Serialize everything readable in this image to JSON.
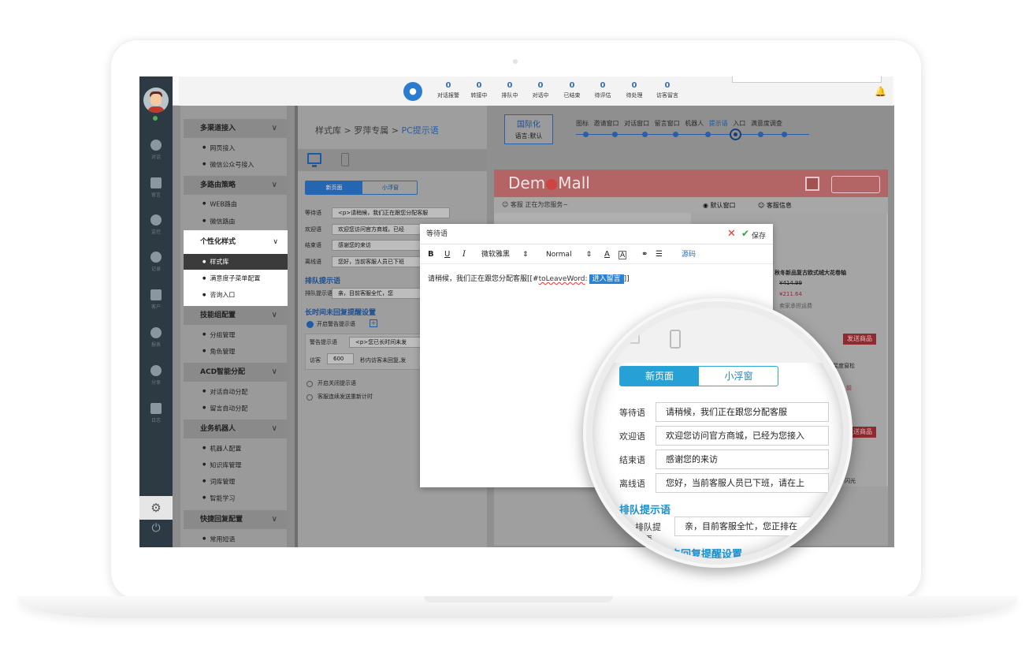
{
  "stats": [
    {
      "num": "0",
      "label": "对话报警"
    },
    {
      "num": "0",
      "label": "转接中"
    },
    {
      "num": "0",
      "label": "排队中"
    },
    {
      "num": "0",
      "label": "对话中"
    },
    {
      "num": "0",
      "label": "已结束"
    },
    {
      "num": "0",
      "label": "待评估"
    },
    {
      "num": "0",
      "label": "待处理"
    },
    {
      "num": "0",
      "label": "访客留言"
    }
  ],
  "leftbar": [
    {
      "icon": "chat-icon",
      "label": "对话"
    },
    {
      "icon": "mail-icon",
      "label": "留言"
    },
    {
      "icon": "eye-icon",
      "label": "监控"
    },
    {
      "icon": "clock-icon",
      "label": "记录"
    },
    {
      "icon": "contacts-icon",
      "label": "客户"
    },
    {
      "icon": "pie-icon",
      "label": "报表"
    },
    {
      "icon": "share-icon",
      "label": "分享"
    },
    {
      "icon": "clipboard-icon",
      "label": "日志"
    }
  ],
  "menu": {
    "sections": [
      {
        "title": "多渠道接入",
        "items": [
          "网页接入",
          "微信公众号接入"
        ]
      },
      {
        "title": "多路由策略",
        "items": [
          "WEB路由",
          "微信路由"
        ]
      },
      {
        "title": "个性化样式",
        "items": [
          "样式库",
          "满意度子菜单配置",
          "咨询入口"
        ]
      },
      {
        "title": "技能组配置",
        "items": [
          "分组管理",
          "角色管理"
        ]
      },
      {
        "title": "ACD智能分配",
        "items": [
          "对话自动分配",
          "留言自动分配"
        ]
      },
      {
        "title": "业务机器人",
        "items": [
          "机器人配置",
          "知识库管理",
          "词库管理",
          "智能学习"
        ]
      },
      {
        "title": "快捷回复配置",
        "items": [
          "常用短语"
        ]
      }
    ]
  },
  "breadcrumb": {
    "c1": "样式库",
    "sep": " > ",
    "c2": "罗萍专属",
    "c3": "PC提示语"
  },
  "tabs": {
    "new_page": "新页面",
    "float_window": "小浮窗"
  },
  "form": {
    "rows": [
      {
        "label": "等待语",
        "value": "<p>请稍候，我们正在跟您分配客服"
      },
      {
        "label": "欢迎语",
        "value": "欢迎您访问官方商城，已经"
      },
      {
        "label": "结束语",
        "value": "感谢您的来访"
      },
      {
        "label": "离线语",
        "value": "您好，当前客服人员已下班"
      }
    ],
    "queue_title": "排队提示语",
    "queue_label": "排队提示语",
    "queue_value": "亲，目前客服全忙，您",
    "timeout_title": "长时间未回复提醒设置",
    "warn_toggle": "开启警告提示语",
    "warn_label": "警告提示语",
    "warn_value": "<p>您已长时间未发",
    "visitor_label": "访客",
    "visitor_value": "600",
    "visitor_suffix": "秒内访客未回复,发",
    "radio1": "开启关闭提示语",
    "radio2": "客服连续发送重新计时"
  },
  "steps": {
    "intl_title": "国际化",
    "intl_lang": "语言:默认",
    "labels": [
      "图标",
      "邀请窗口",
      "对话窗口",
      "留言窗口",
      "机器人",
      "提示语",
      "入口",
      "满意度调查"
    ]
  },
  "mall": {
    "logo_a": "Dem",
    "logo_b": "Mall",
    "service_text": "客服 正在为您服务~",
    "tab_default": "默认窗口",
    "tab_info": "客服信息",
    "product1": "秋冬新品复古欧式绒大花卷轴",
    "price_old": "¥414.99",
    "price_new": "¥211.64",
    "seller": "卖家承担运费",
    "send_label": "发送商品",
    "product2": "星度窗松",
    "product2_line": "前",
    "product3": "闪光",
    "send_label2": "发送商品"
  },
  "modal": {
    "title": "等待语",
    "save": "保存",
    "toolbar": {
      "bold": "B",
      "underline": "U",
      "italic": "I",
      "font": "微软雅黑",
      "size": "Normal",
      "source": "源码"
    },
    "body_text": "请稍候，我们正在跟您分配客服[[#",
    "body_wavy": "toLeaveWord",
    "body_colon": ":",
    "body_tag": "进入留言",
    "body_end": "]]"
  },
  "lens": {
    "rows": [
      {
        "label": "等待语",
        "value": "请稍候，我们正在跟您分配客服"
      },
      {
        "label": "欢迎语",
        "value": "欢迎您访问官方商城，已经为您接入"
      },
      {
        "label": "结束语",
        "value": "感谢您的来访"
      },
      {
        "label": "离线语",
        "value": "您好，当前客服人员已下班，请在上"
      }
    ],
    "queue_title": "排队提示语",
    "queue_label": "排队提示语",
    "queue_value": "亲，目前客服全忙，您正排在",
    "timeout_title": "长时间未回复提醒设置"
  }
}
